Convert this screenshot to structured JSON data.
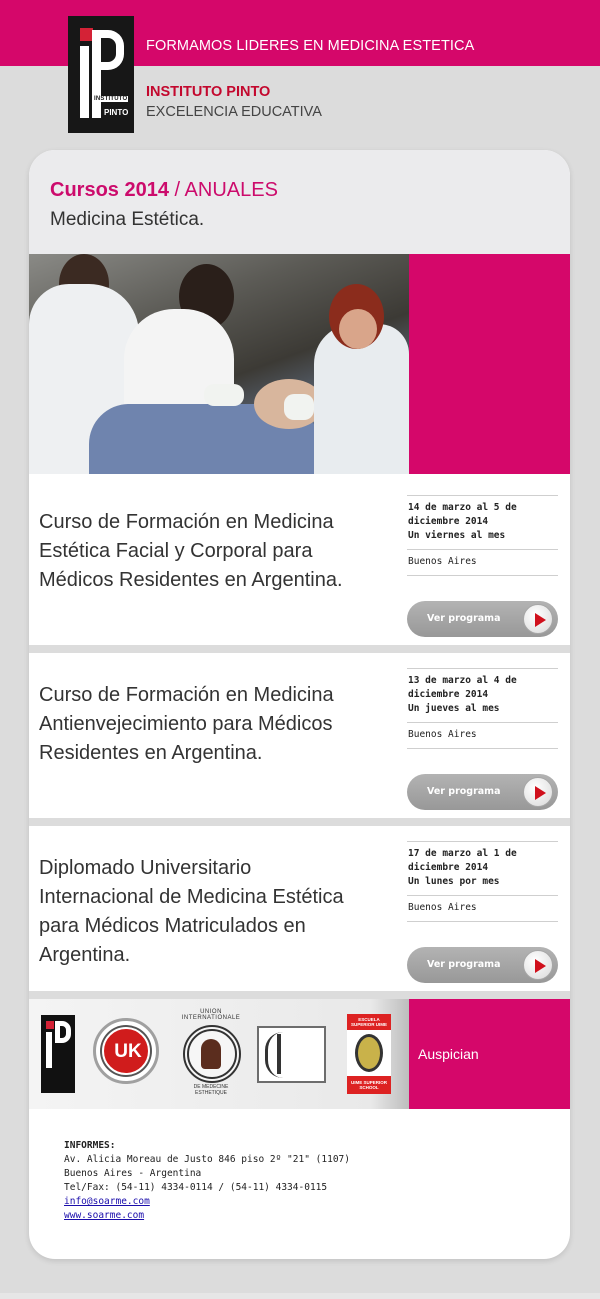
{
  "header": {
    "logo_line1": "INSTITUTO",
    "logo_line2": "PINTO",
    "slogan": "FORMAMOS LIDERES EN MEDICINA ESTETICA",
    "institute_name": "INSTITUTO PINTO",
    "tagline": "EXCELENCIA EDUCATIVA"
  },
  "hero": {
    "title_strong": "Cursos 2014",
    "title_light": " / ANUALES",
    "subtitle": "Medicina Estética."
  },
  "courses": [
    {
      "title": "Curso de Formación en Medicina Estética Facial y Corporal para Médicos Residentes en Argentina.",
      "dates": "14 de marzo al 5 de diciembre 2014",
      "frequency": "Un viernes al mes",
      "location": "Buenos Aires",
      "button_label": "Ver programa"
    },
    {
      "title": "Curso de Formación en Medicina Antienvejecimiento para Médicos Residentes en Argentina.",
      "dates": "13 de marzo al 4 de diciembre 2014",
      "frequency": "Un jueves al mes",
      "location": "Buenos Aires",
      "button_label": "Ver programa"
    },
    {
      "title": "Diplomado Universitario Internacional de Medicina Estética para Médicos Matriculados en Argentina.",
      "dates": "17 de marzo al 1 de diciembre 2014",
      "frequency": "Un lunes por mes",
      "location": "Buenos Aires",
      "button_label": "Ver programa"
    }
  ],
  "sponsors": {
    "label": "Auspician",
    "logos": [
      "Instituto Pinto",
      "UK",
      "Union Internationale de Medecine Esthetique",
      "Sociedad Argentina de Medicina Estetica SOARME",
      "UIME Escuela Superior"
    ],
    "uk_text": "UK",
    "union_top": "UNION INTERNATIONALE",
    "union_bottom": "DE MEDECINE ESTHETIQUE",
    "uime_top": "ESCUELA SUPERIOR UIME",
    "uime_bottom": "UIME SUPERIOR SCHOOL"
  },
  "footer": {
    "heading": "INFORMES:",
    "address": "Av. Alicia Moreau de Justo 846 piso 2º \"21\" (1107)",
    "city": "Buenos Aires - Argentina",
    "phones": "Tel/Fax: (54-11) 4334-0114 / (54-11) 4334-0115",
    "email": "info@soarme.com",
    "website": "www.soarme.com"
  },
  "colors": {
    "brand_magenta": "#d5076a",
    "brand_red": "#c3082e",
    "background": "#dcdcdc"
  }
}
